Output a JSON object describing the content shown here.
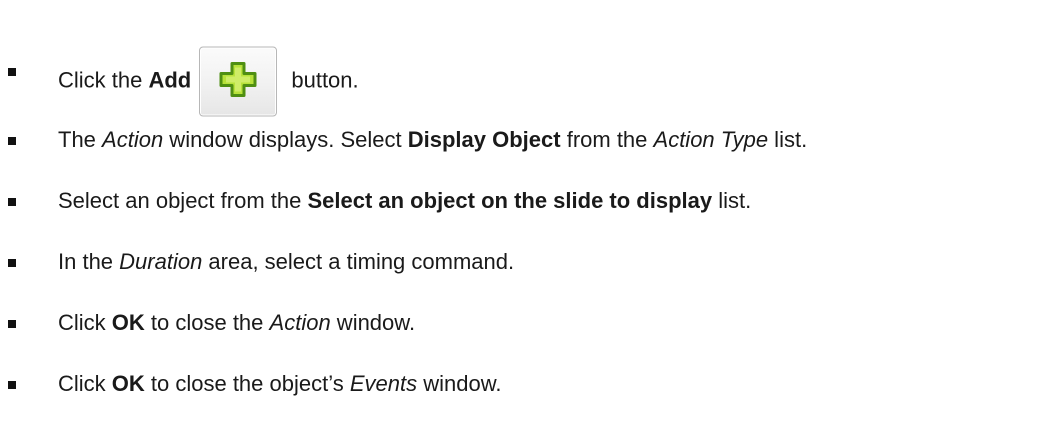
{
  "steps": [
    {
      "parts": [
        {
          "t": "Click the ",
          "s": "normal"
        },
        {
          "t": "Add",
          "s": "bold"
        },
        {
          "t": "BUTTON",
          "s": "button"
        },
        {
          "t": " button.",
          "s": "normal"
        }
      ]
    },
    {
      "parts": [
        {
          "t": "The ",
          "s": "normal"
        },
        {
          "t": "Action",
          "s": "italic"
        },
        {
          "t": " window displays. Select ",
          "s": "normal"
        },
        {
          "t": "Display Object",
          "s": "bold"
        },
        {
          "t": " from the ",
          "s": "normal"
        },
        {
          "t": "Action Type",
          "s": "italic"
        },
        {
          "t": " list.",
          "s": "normal"
        }
      ]
    },
    {
      "parts": [
        {
          "t": "Select an object from the ",
          "s": "normal"
        },
        {
          "t": "Select an object on the slide to display",
          "s": "bold"
        },
        {
          "t": " list.",
          "s": "normal"
        }
      ]
    },
    {
      "parts": [
        {
          "t": "In the ",
          "s": "normal"
        },
        {
          "t": "Duration",
          "s": "italic"
        },
        {
          "t": " area, select a timing command.",
          "s": "normal"
        }
      ]
    },
    {
      "parts": [
        {
          "t": "Click ",
          "s": "normal"
        },
        {
          "t": "OK",
          "s": "bold"
        },
        {
          "t": " to close the ",
          "s": "normal"
        },
        {
          "t": "Action",
          "s": "italic"
        },
        {
          "t": " window.",
          "s": "normal"
        }
      ]
    },
    {
      "parts": [
        {
          "t": "Click ",
          "s": "normal"
        },
        {
          "t": "OK",
          "s": "bold"
        },
        {
          "t": " to close the object’s ",
          "s": "normal"
        },
        {
          "t": "Events",
          "s": "italic"
        },
        {
          "t": " window.",
          "s": "normal"
        }
      ]
    }
  ],
  "add_button": {
    "icon": "plus-icon",
    "icon_fill": "#b7e23a",
    "icon_stroke": "#4f8f12"
  }
}
